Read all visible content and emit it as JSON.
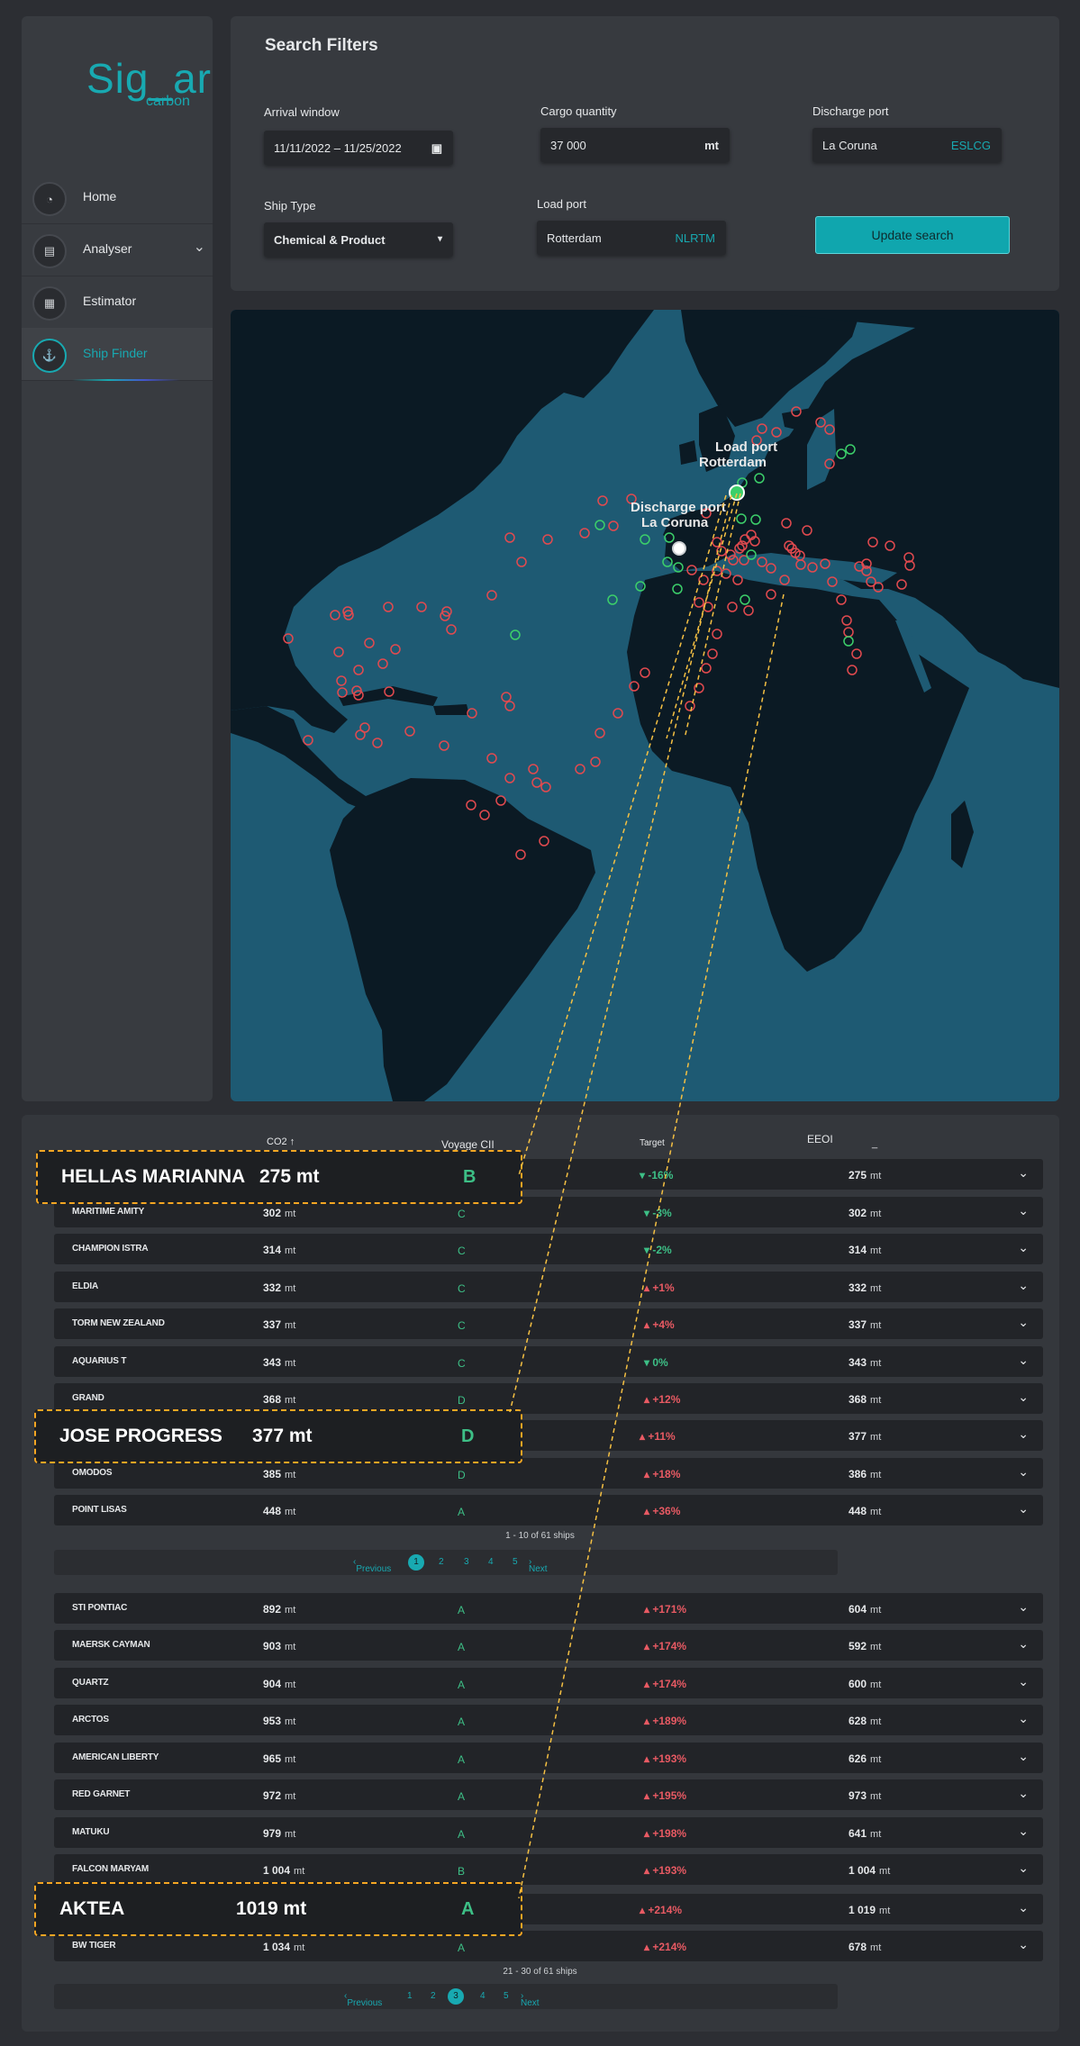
{
  "brand": {
    "name": "Sig_ar",
    "sub": "carbon"
  },
  "sidebar": {
    "items": [
      {
        "label": "Home"
      },
      {
        "label": "Analyser"
      },
      {
        "label": "Estimator"
      },
      {
        "label": "Ship Finder"
      }
    ]
  },
  "filters": {
    "title": "Search Filters",
    "arrival_label": "Arrival window",
    "arrival_value": "11/11/2022 – 11/25/2022",
    "cargo_label": "Cargo quantity",
    "cargo_value": "37 000",
    "cargo_unit": "mt",
    "discharge_label": "Discharge port",
    "discharge_value": "La Coruna",
    "discharge_code": "ESLCG",
    "shiptype_label": "Ship Type",
    "shiptype_value": "Chemical & Product",
    "load_label": "Load port",
    "load_value": "Rotterdam",
    "load_code": "NLRTM",
    "update_label": "Update search"
  },
  "map": {
    "load_label_1": "Load port",
    "load_label_2": "Rotterdam",
    "discharge_label_1": "Discharge port",
    "discharge_label_2": "La Coruna",
    "colors": {
      "ocean": "#1e5a73",
      "land": "#0b1a24",
      "ship_bad": "#e24a4f",
      "ship_good": "#3ccf6a",
      "route": "#f5c043"
    }
  },
  "table": {
    "headers": {
      "co2": "CO2",
      "cii": "Voyage CII",
      "target": "Target",
      "eeoi": "EEOI",
      "eeoi_extra": "_"
    },
    "unit": "mt",
    "page1_rows": [
      {
        "name": "MARITIME AMITY",
        "co2": "302",
        "cii": "C",
        "target": "-3%",
        "dir": "dn",
        "eeoi": "302"
      },
      {
        "name": "CHAMPION ISTRA",
        "co2": "314",
        "cii": "C",
        "target": "-2%",
        "dir": "dn",
        "eeoi": "314"
      },
      {
        "name": "ELDIA",
        "co2": "332",
        "cii": "C",
        "target": "+1%",
        "dir": "up",
        "eeoi": "332"
      },
      {
        "name": "TORM NEW ZEALAND",
        "co2": "337",
        "cii": "C",
        "target": "+4%",
        "dir": "up",
        "eeoi": "337"
      },
      {
        "name": "AQUARIUS T",
        "co2": "343",
        "cii": "C",
        "target": "0%",
        "dir": "dn",
        "eeoi": "343"
      },
      {
        "name": "GRAND",
        "co2": "368",
        "cii": "D",
        "target": "+12%",
        "dir": "up",
        "eeoi": "368"
      },
      {
        "name": "OMODOS",
        "co2": "385",
        "cii": "D",
        "target": "+18%",
        "dir": "up",
        "eeoi": "386"
      },
      {
        "name": "POINT LISAS",
        "co2": "448",
        "cii": "A",
        "target": "+36%",
        "dir": "up",
        "eeoi": "448"
      }
    ],
    "hl_row1": {
      "target": "-16%",
      "eeoi": "275"
    },
    "hl_row2": {
      "target": "+11%",
      "eeoi": "377"
    },
    "count1": "1 - 10 of 61 ships",
    "page2_rows": [
      {
        "name": "STI PONTIAC",
        "co2": "892",
        "cii": "A",
        "target": "+171%",
        "eeoi": "604"
      },
      {
        "name": "MAERSK CAYMAN",
        "co2": "903",
        "cii": "A",
        "target": "+174%",
        "eeoi": "592"
      },
      {
        "name": "QUARTZ",
        "co2": "904",
        "cii": "A",
        "target": "+174%",
        "eeoi": "600"
      },
      {
        "name": "ARCTOS",
        "co2": "953",
        "cii": "A",
        "target": "+189%",
        "eeoi": "628"
      },
      {
        "name": "AMERICAN LIBERTY",
        "co2": "965",
        "cii": "A",
        "target": "+193%",
        "eeoi": "626"
      },
      {
        "name": "RED GARNET",
        "co2": "972",
        "cii": "A",
        "target": "+195%",
        "eeoi": "973"
      },
      {
        "name": "MATUKU",
        "co2": "979",
        "cii": "A",
        "target": "+198%",
        "eeoi": "641"
      },
      {
        "name": "FALCON MARYAM",
        "co2": "1 004",
        "cii": "B",
        "target": "+193%",
        "eeoi": "1 004"
      },
      {
        "name": "BW TIGER",
        "co2": "1 034",
        "cii": "A",
        "target": "+214%",
        "eeoi": "678"
      }
    ],
    "hl_row3": {
      "target": "+214%",
      "eeoi": "1 019"
    },
    "count2": "21 - 30 of 61 ships",
    "pager": {
      "prev": "Previous",
      "next": "Next",
      "pages1": [
        "1",
        "2",
        "3",
        "4",
        "5"
      ],
      "pages2": [
        "1",
        "2",
        "3",
        "4",
        "5"
      ]
    }
  },
  "callouts": [
    {
      "name": "HELLAS MARIANNA",
      "value": "275 mt",
      "cii": "B"
    },
    {
      "name": "JOSE PROGRESS",
      "value": "377 mt",
      "cii": "D"
    },
    {
      "name": "AKTEA",
      "value": "1019 mt",
      "cii": "A"
    }
  ]
}
